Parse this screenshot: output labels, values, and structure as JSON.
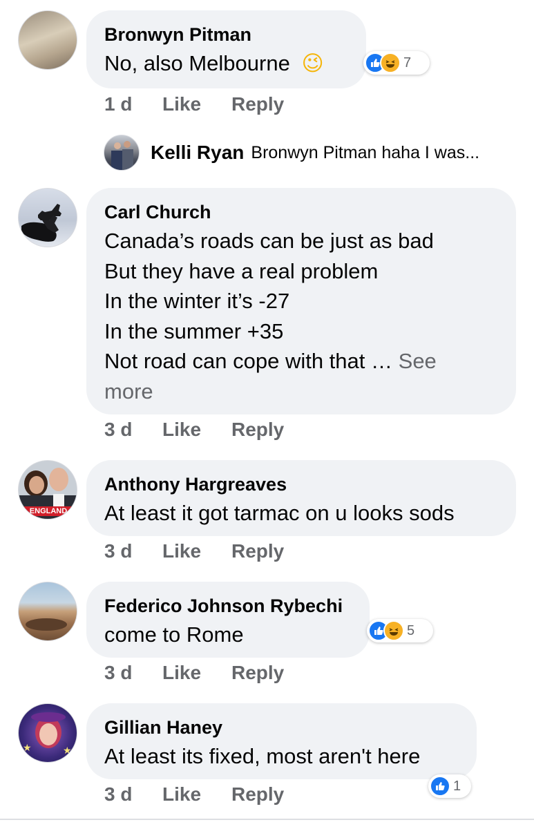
{
  "comments": [
    {
      "author": "Bronwyn Pitman",
      "lines": [
        "No, also Melbourne"
      ],
      "emoji": "😉",
      "time": "1 d",
      "like_label": "Like",
      "reply_label": "Reply",
      "reaction_count": "7",
      "reactions": [
        "like",
        "haha"
      ]
    },
    {
      "author": "Carl Church",
      "lines": [
        "Canada’s roads can be just as bad",
        "But they have a real problem",
        "In the winter it’s -27",
        "In the summer +35",
        "Not road can cope with that …"
      ],
      "see_more": "See",
      "see_more_2": "more",
      "time": "3 d",
      "like_label": "Like",
      "reply_label": "Reply"
    },
    {
      "author": "Anthony Hargreaves",
      "lines": [
        "At least it got tarmac on u looks sods"
      ],
      "avatar_badge": "ENGLAND",
      "time": "3 d",
      "like_label": "Like",
      "reply_label": "Reply"
    },
    {
      "author": "Federico Johnson Rybechi",
      "lines": [
        "come to Rome"
      ],
      "time": "3 d",
      "like_label": "Like",
      "reply_label": "Reply",
      "reaction_count": "5",
      "reactions": [
        "like",
        "haha"
      ]
    },
    {
      "author": "Gillian Haney",
      "lines": [
        "At least its fixed, most aren't here"
      ],
      "time": "3 d",
      "like_label": "Like",
      "reply_label": "Reply",
      "reaction_count": "1",
      "reactions": [
        "like"
      ]
    }
  ],
  "reply_preview": {
    "author": "Kelli Ryan",
    "snippet": "Bronwyn Pitman haha I was..."
  },
  "colors": {
    "bubble": "#f0f2f5",
    "meta_text": "#65676b",
    "like_blue": "#1877f2",
    "haha_yellow": "#f7b125"
  }
}
